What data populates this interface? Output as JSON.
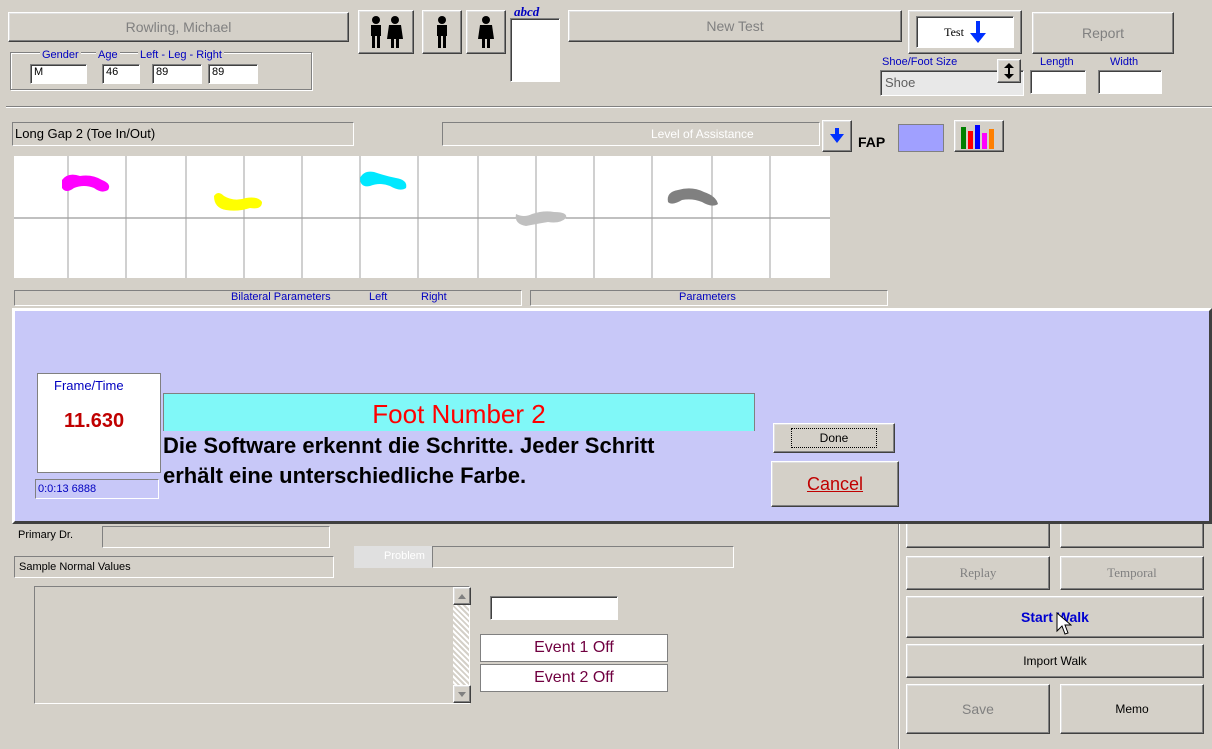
{
  "patient": {
    "name": "Rowling, Michael"
  },
  "demographics": {
    "gender_label": "Gender",
    "age_label": "Age",
    "legs_label": "Left - Leg - Right",
    "gender": "M",
    "age": "46",
    "left_leg": "89",
    "right_leg": "89"
  },
  "toolbar": {
    "abcd_label": "abcd",
    "new_test": "New Test",
    "test": "Test",
    "report": "Report"
  },
  "shoe": {
    "label": "Shoe/Foot Size",
    "value": "Shoe",
    "length_label": "Length",
    "width_label": "Width"
  },
  "test_panel": {
    "test_name": "Long Gap 2 (Toe In/Out)",
    "assistance_label": "Level of Assistance",
    "fap_label": "FAP"
  },
  "parameters_bar": {
    "bilateral": "Bilateral Parameters",
    "left": "Left",
    "right": "Right",
    "parameters": "Parameters"
  },
  "footprints": [
    {
      "color": "#ff00ff"
    },
    {
      "color": "#ffff00"
    },
    {
      "color": "#00e8ff"
    },
    {
      "color": "#c0c0c0"
    },
    {
      "color": "#808080"
    }
  ],
  "dialog": {
    "frame_time_label": "Frame/Time",
    "frame_time_value": "11.630",
    "timecode": "0:0:13 6888",
    "foot_number": "Foot Number 2",
    "caption_line1": "Die Software erkennt die Schritte. Jeder Schritt",
    "caption_line2": "erhält eine unterschiedliche Farbe.",
    "done": "Done",
    "cancel": "Cancel"
  },
  "lower": {
    "primary_dr_label": "Primary Dr.",
    "sample_normal": "Sample Normal Values",
    "problem_label": "Problem",
    "event1": "Event 1 Off",
    "event2": "Event 2 Off"
  },
  "right_buttons": {
    "replay": "Replay",
    "temporal": "Temporal",
    "start_walk": "Start Walk",
    "import_walk": "Import Walk",
    "save": "Save",
    "memo": "Memo"
  }
}
